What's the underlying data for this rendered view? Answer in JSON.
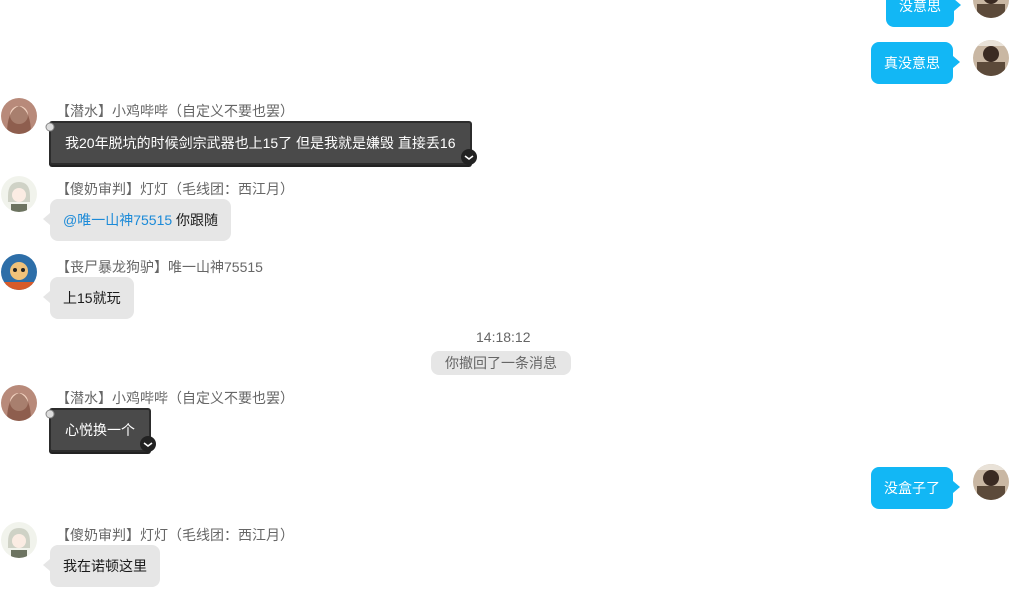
{
  "messages": [
    {
      "id": "m1",
      "text": "没意思"
    },
    {
      "id": "m2",
      "text": "真没意思"
    },
    {
      "id": "m3",
      "sender": "【潜水】小鸡哔哔（自定义不要也罢）",
      "text": "我20年脱坑的时候剑宗武器也上15了 但是我就是嫌毁 直接丢16"
    },
    {
      "id": "m4",
      "sender": "【傻奶审判】灯灯（毛线团：西江月）",
      "mention": "@唯一山神75515",
      "text": " 你跟随"
    },
    {
      "id": "m5",
      "sender": "【丧尸暴龙狗驴】唯一山神75515",
      "text": "上15就玩"
    },
    {
      "id": "m6",
      "sender": "【潜水】小鸡哔哔（自定义不要也罢）",
      "text": "心悦换一个"
    },
    {
      "id": "m7",
      "text": "没盒子了"
    },
    {
      "id": "m8",
      "sender": "【傻奶审判】灯灯（毛线团：西江月）",
      "text": "我在诺顿这里"
    }
  ],
  "timestamp": "14:18:12",
  "recall_notice": "你撤回了一条消息",
  "colors": {
    "outgoing": "#12b7f5",
    "incoming": "#e6e6e6",
    "dark_bubble": "#4a4a4a",
    "mention": "#1b8ad8"
  }
}
